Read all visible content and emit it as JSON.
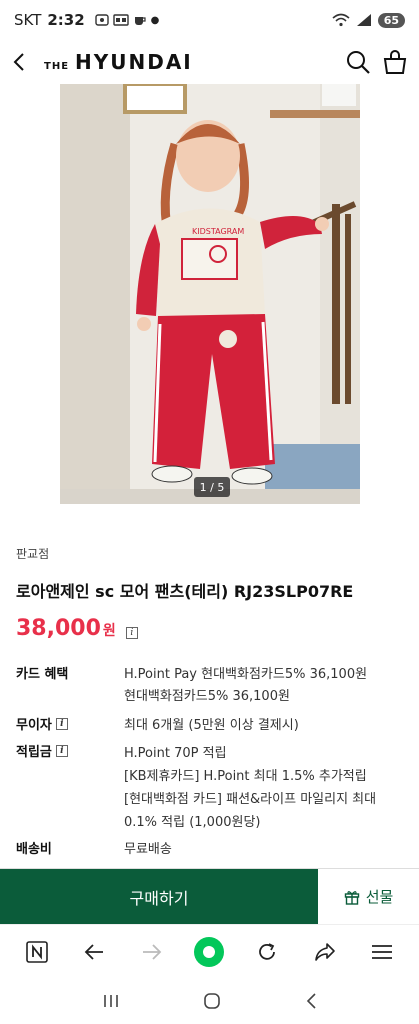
{
  "status": {
    "carrier": "SKT",
    "time": "2:32",
    "battery": "65"
  },
  "header": {
    "brand_prefix": "THE",
    "brand_name": "HYUNDAI"
  },
  "gallery": {
    "counter": "1 / 5"
  },
  "product": {
    "store": "판교점",
    "title": "로아앤제인 sc 모어 팬츠(테리) RJ23SLP07RE",
    "price": "38,000",
    "currency": "원"
  },
  "details": [
    {
      "label": "카드 혜택",
      "lines": [
        "H.Point Pay 현대백화점카드5% 36,100원",
        "현대백화점카드5% 36,100원"
      ],
      "info": false
    },
    {
      "label": "무이자",
      "lines": [
        "최대 6개월 (5만원 이상 결제시)"
      ],
      "info": true
    },
    {
      "label": "적립금",
      "lines": [
        "H.Point 70P 적립",
        "[KB제휴카드] H.Point 최대 1.5% 추가적립",
        "[현대백화점 카드] 패션&라이프 마일리지 최대",
        "0.1% 적립 (1,000원당)"
      ],
      "info": true
    },
    {
      "label": "배송비",
      "lines": [
        "무료배송"
      ],
      "info": false
    }
  ],
  "actions": {
    "buy": "구매하기",
    "gift": "선물"
  },
  "colors": {
    "brand_green": "#0b5c3a",
    "price_red": "#e8304a",
    "naver_green": "#03c75a"
  },
  "icons": [
    "back-arrow-icon",
    "search-icon",
    "shopping-bag-icon",
    "info-icon",
    "gift-icon",
    "naver-n-icon",
    "browser-back-icon",
    "browser-forward-icon",
    "naver-green-dot-icon",
    "refresh-icon",
    "share-icon",
    "menu-icon",
    "recent-apps-icon",
    "home-icon",
    "system-back-icon"
  ]
}
